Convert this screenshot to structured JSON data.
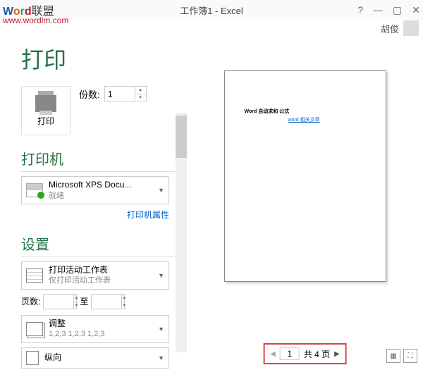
{
  "watermark": {
    "brand_cn": "联盟",
    "url": "www.wordlm.com"
  },
  "titlebar": {
    "title": "工作簿1 - Excel",
    "help": "?",
    "min": "—",
    "max": "▢",
    "close": "✕"
  },
  "user": {
    "name": "胡俊"
  },
  "page_title": "打印",
  "print": {
    "label": "打印",
    "copies_label": "份数:",
    "copies_value": "1"
  },
  "printer": {
    "heading": "打印机",
    "name": "Microsoft XPS Docu...",
    "status": "就绪",
    "props_link": "打印机属性"
  },
  "settings": {
    "heading": "设置",
    "scope": {
      "title": "打印活动工作表",
      "sub": "仅打印活动工作表"
    },
    "pages_label": "页数:",
    "pages_from": "",
    "pages_to_label": "至",
    "pages_to": "",
    "collate": {
      "title": "调整",
      "sub": "1,2,3    1,2,3    1,2,3"
    },
    "orientation": "纵向"
  },
  "preview": {
    "text1": "Word 自动求和 公式",
    "text2": "word 相关文章"
  },
  "nav": {
    "current": "1",
    "total_label": "共 4 页"
  }
}
